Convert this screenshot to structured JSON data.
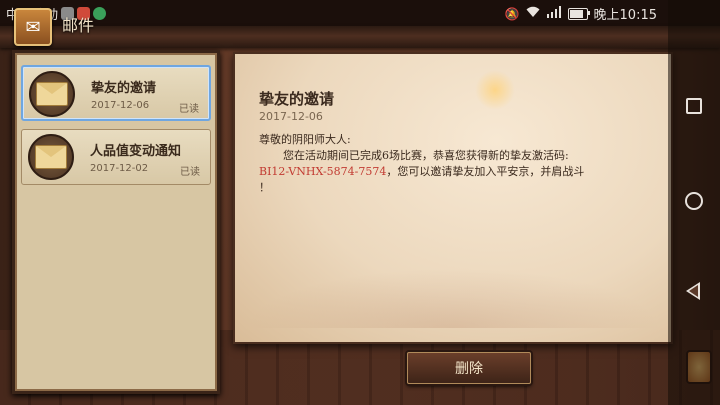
{
  "status_bar": {
    "carrier": "中国移动",
    "time": "晚上10:15",
    "battery_level": 0.8,
    "icons": [
      "mute-icon",
      "wifi-icon",
      "signal-4g-icon",
      "battery-icon"
    ]
  },
  "header": {
    "title": "邮件",
    "icon": "mail-icon"
  },
  "mail_list": [
    {
      "title": "挚友的邀请",
      "date": "2017-12-06",
      "status": "已读",
      "selected": true
    },
    {
      "title": "人品值变动通知",
      "date": "2017-12-02",
      "status": "已读",
      "selected": false
    }
  ],
  "letter": {
    "title": "挚友的邀请",
    "date": "2017-12-06",
    "greeting": "尊敬的阴阳师大人:",
    "line1": "您在活动期间已完成6场比赛，恭喜您获得新的挚友激活码:",
    "code": "BI12-VNHX-5874-7574",
    "line2": "，您可以邀请挚友加入平安京，并肩战斗",
    "line3": "！"
  },
  "actions": {
    "delete_label": "删除"
  },
  "colors": {
    "code_red": "#c23b32",
    "selected_border": "#6fa6e0"
  }
}
